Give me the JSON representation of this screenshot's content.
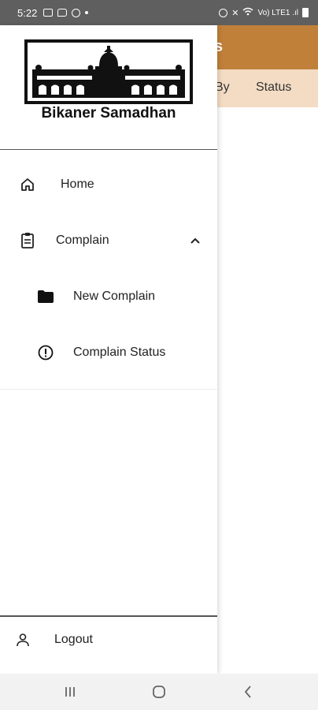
{
  "status_bar": {
    "time": "5:22",
    "right_text": "Vo) LTE1 .ıl",
    "icons": [
      "image-icon",
      "chat-icon",
      "circle-icon",
      "dot-icon",
      "alarm-icon",
      "mute-icon",
      "wifi-icon",
      "signal-icon",
      "battery-icon"
    ]
  },
  "background_app": {
    "toolbar_title_fragment": "s",
    "toolbar_color": "#c1803a",
    "header_color": "#f4dcc4",
    "header_columns": [
      "By",
      "Status"
    ]
  },
  "drawer": {
    "app_title": "Bikaner Samadhan",
    "menu": {
      "home": "Home",
      "complain": "Complain",
      "new_complain": "New Complain",
      "complain_status": "Complain Status"
    },
    "logout": "Logout"
  },
  "nav_bar": {
    "icons": [
      "recent-apps-icon",
      "home-circle-icon",
      "back-chevron-icon"
    ]
  }
}
